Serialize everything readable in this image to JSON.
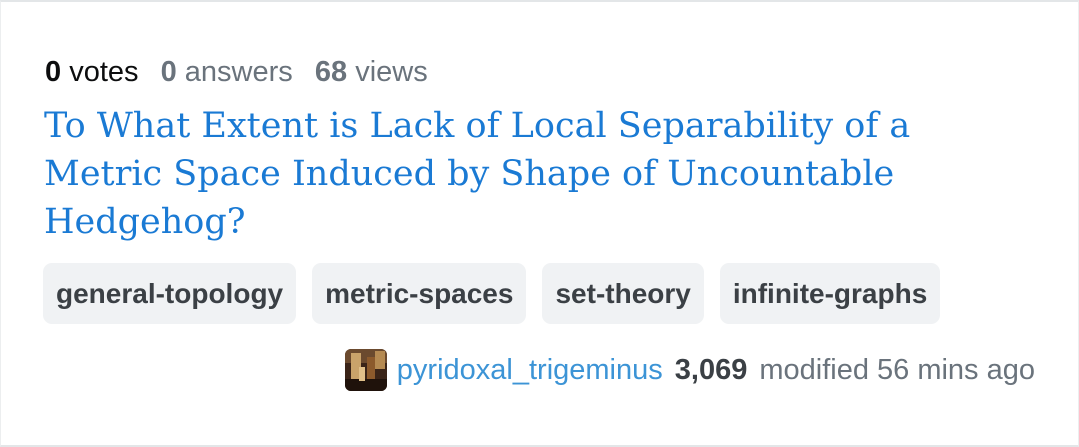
{
  "question": {
    "stats": {
      "votes_num": "0",
      "votes_label": "votes",
      "answers_num": "0",
      "answers_label": "answers",
      "views_num": "68",
      "views_label": "views"
    },
    "title": "To What Extent is Lack of Local Separability of a Metric Space Induced by Shape of Uncountable Hedgehog?",
    "tags": [
      "general-topology",
      "metric-spaces",
      "set-theory",
      "infinite-graphs"
    ],
    "owner": {
      "username": "pyridoxal_trigeminus",
      "reputation": "3,069",
      "activity": "modified 56 mins ago"
    }
  },
  "colors": {
    "link": "#1a7ad4",
    "username": "#3c94d6",
    "tag_bg": "#f0f2f4",
    "tag_text": "#3b4045",
    "muted": "#6a737c"
  }
}
